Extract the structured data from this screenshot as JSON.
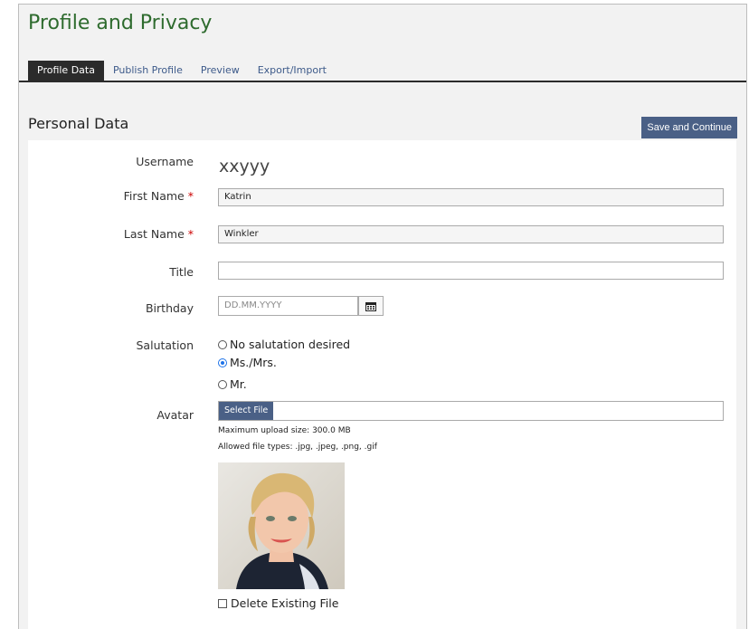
{
  "header": {
    "title": "Profile and Privacy"
  },
  "tabs": [
    {
      "label": "Profile Data",
      "active": true
    },
    {
      "label": "Publish Profile",
      "active": false
    },
    {
      "label": "Preview",
      "active": false
    },
    {
      "label": "Export/Import",
      "active": false
    }
  ],
  "section": {
    "title": "Personal Data",
    "save_label": "Save and Continue"
  },
  "form": {
    "username": {
      "label": "Username",
      "value": "xxyyy"
    },
    "first_name": {
      "label": "First Name",
      "required_mark": "*",
      "value": "Katrin"
    },
    "last_name": {
      "label": "Last Name",
      "required_mark": "*",
      "value": "Winkler"
    },
    "title": {
      "label": "Title",
      "value": ""
    },
    "birthday": {
      "label": "Birthday",
      "placeholder": "DD.MM.YYYY",
      "icon": "calendar-icon"
    },
    "salutation": {
      "label": "Salutation",
      "options": [
        {
          "label": "No salutation desired",
          "selected": false
        },
        {
          "label": "Ms./Mrs.",
          "selected": true
        },
        {
          "label": "Mr.",
          "selected": false
        }
      ]
    },
    "avatar": {
      "label": "Avatar",
      "select_label": "Select File",
      "max_size": "Maximum upload size: 300.0 MB",
      "allowed_types": "Allowed file types: .jpg, .jpeg, .png, .gif",
      "delete_label": "Delete Existing File"
    }
  },
  "colors": {
    "accent": "#4a6086",
    "title_green": "#2e6b2e",
    "required": "#cc0000",
    "radio_selected": "#1e73e8"
  }
}
